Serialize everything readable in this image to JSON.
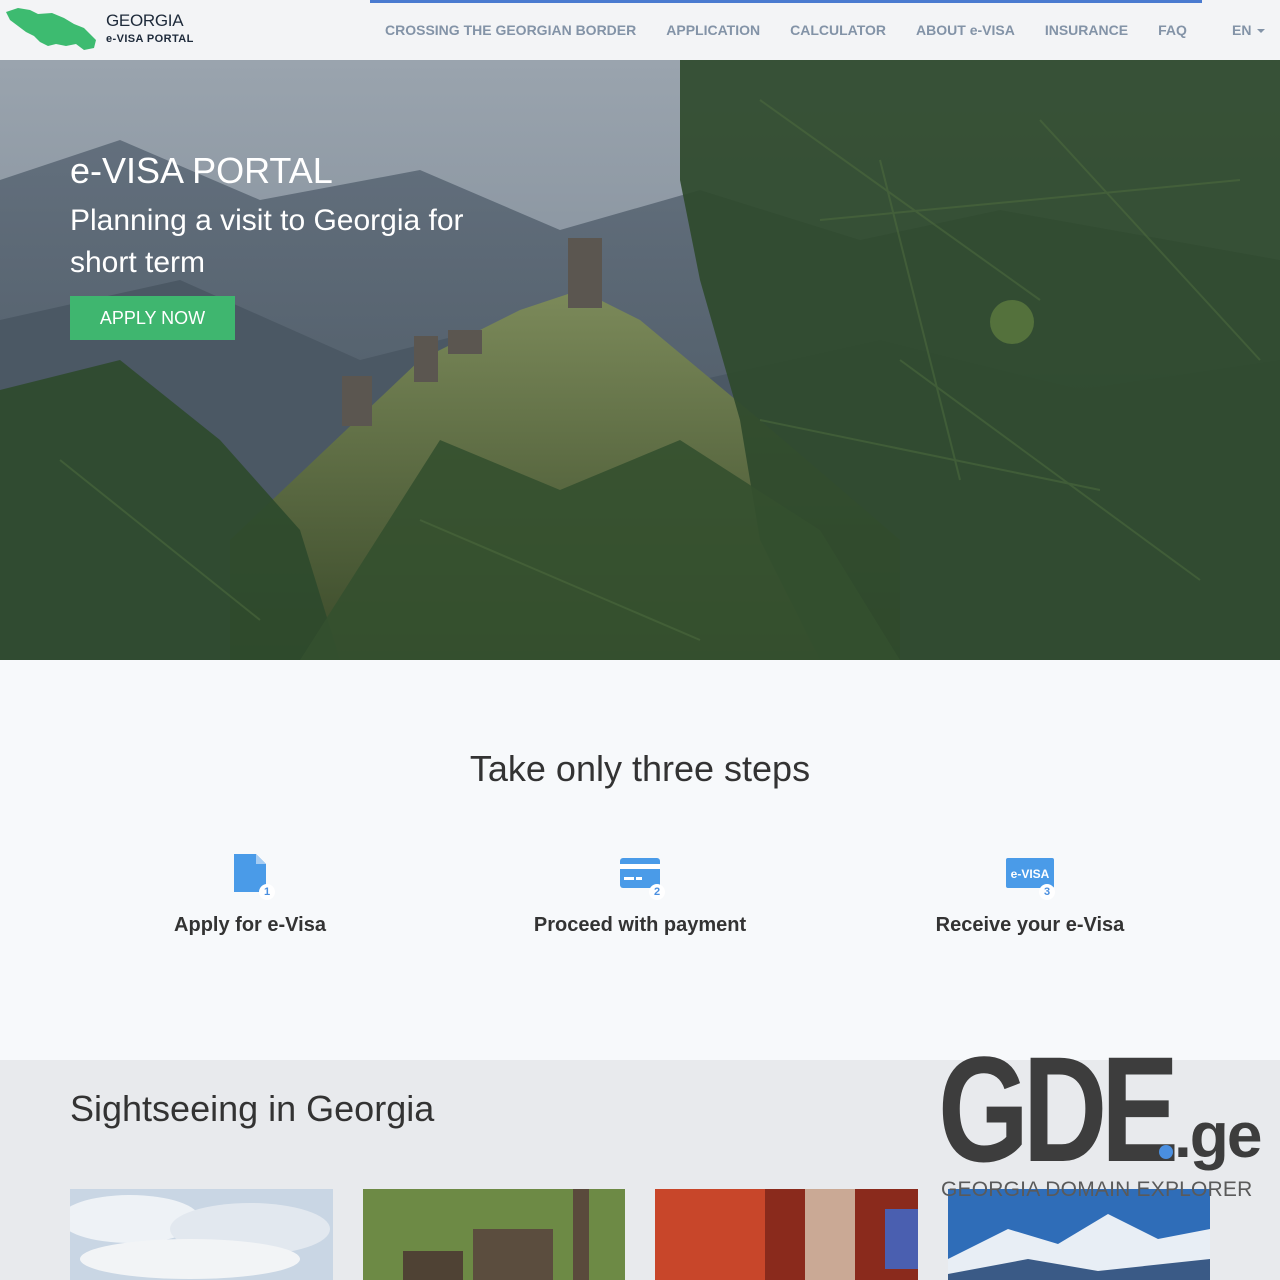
{
  "logo": {
    "line1": "GEORGIA",
    "line2": "e-VISA PORTAL",
    "color": "#3dbb70"
  },
  "nav": {
    "items": [
      "CROSSING THE GEORGIAN BORDER",
      "APPLICATION",
      "CALCULATOR",
      "ABOUT e-VISA",
      "INSURANCE",
      "FAQ"
    ],
    "lang": "EN",
    "accent": "#4a7bd0"
  },
  "hero": {
    "title": "e-VISA PORTAL",
    "subtitle": "Planning a visit to Georgia for short term",
    "cta": "APPLY NOW",
    "cta_color": "#3fb66f"
  },
  "steps": {
    "title": "Take only three steps",
    "items": [
      {
        "label": "Apply for e-Visa",
        "num": "1",
        "icon": "document-icon"
      },
      {
        "label": "Proceed with payment",
        "num": "2",
        "icon": "credit-card-icon"
      },
      {
        "label": "Receive your e-Visa",
        "num": "3",
        "icon": "evisa-icon",
        "icon_text": "e-VISA"
      }
    ],
    "icon_color": "#4a9be8"
  },
  "sights": {
    "title": "Sightseeing in Georgia"
  },
  "watermark": {
    "word": "GDE",
    "tld": ".ge",
    "tagline": "GEORGIA DOMAIN EXPLORER"
  }
}
